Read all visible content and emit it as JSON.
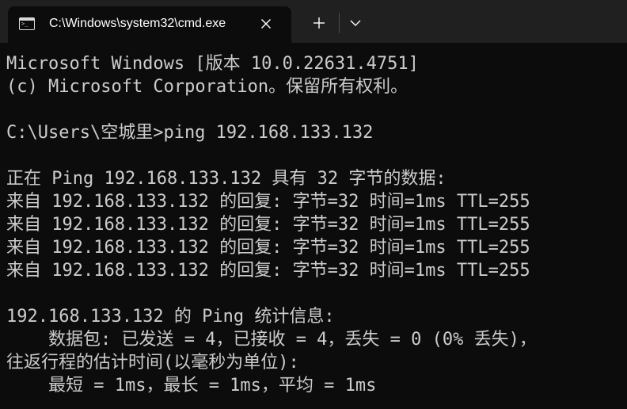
{
  "window": {
    "tab_title": "C:\\Windows\\system32\\cmd.exe",
    "tab_icon": "cmd-terminal-icon",
    "close_icon": "close-icon",
    "new_tab_icon": "plus-icon",
    "dropdown_icon": "chevron-down-icon"
  },
  "terminal": {
    "lines": [
      "Microsoft Windows [版本 10.0.22631.4751]",
      "(c) Microsoft Corporation。保留所有权利。",
      "",
      "C:\\Users\\空城里>ping 192.168.133.132",
      "",
      "正在 Ping 192.168.133.132 具有 32 字节的数据:",
      "来自 192.168.133.132 的回复: 字节=32 时间=1ms TTL=255",
      "来自 192.168.133.132 的回复: 字节=32 时间=1ms TTL=255",
      "来自 192.168.133.132 的回复: 字节=32 时间=1ms TTL=255",
      "来自 192.168.133.132 的回复: 字节=32 时间=1ms TTL=255",
      "",
      "192.168.133.132 的 Ping 统计信息:",
      "    数据包: 已发送 = 4，已接收 = 4，丢失 = 0 (0% 丢失)，",
      "往返行程的估计时间(以毫秒为单位):",
      "    最短 = 1ms，最长 = 1ms，平均 = 1ms"
    ]
  },
  "colors": {
    "terminal_background": "#0c0c0c",
    "terminal_text": "#cccccc",
    "tab_strip": "#202020",
    "active_tab": "#0c0c0c"
  }
}
